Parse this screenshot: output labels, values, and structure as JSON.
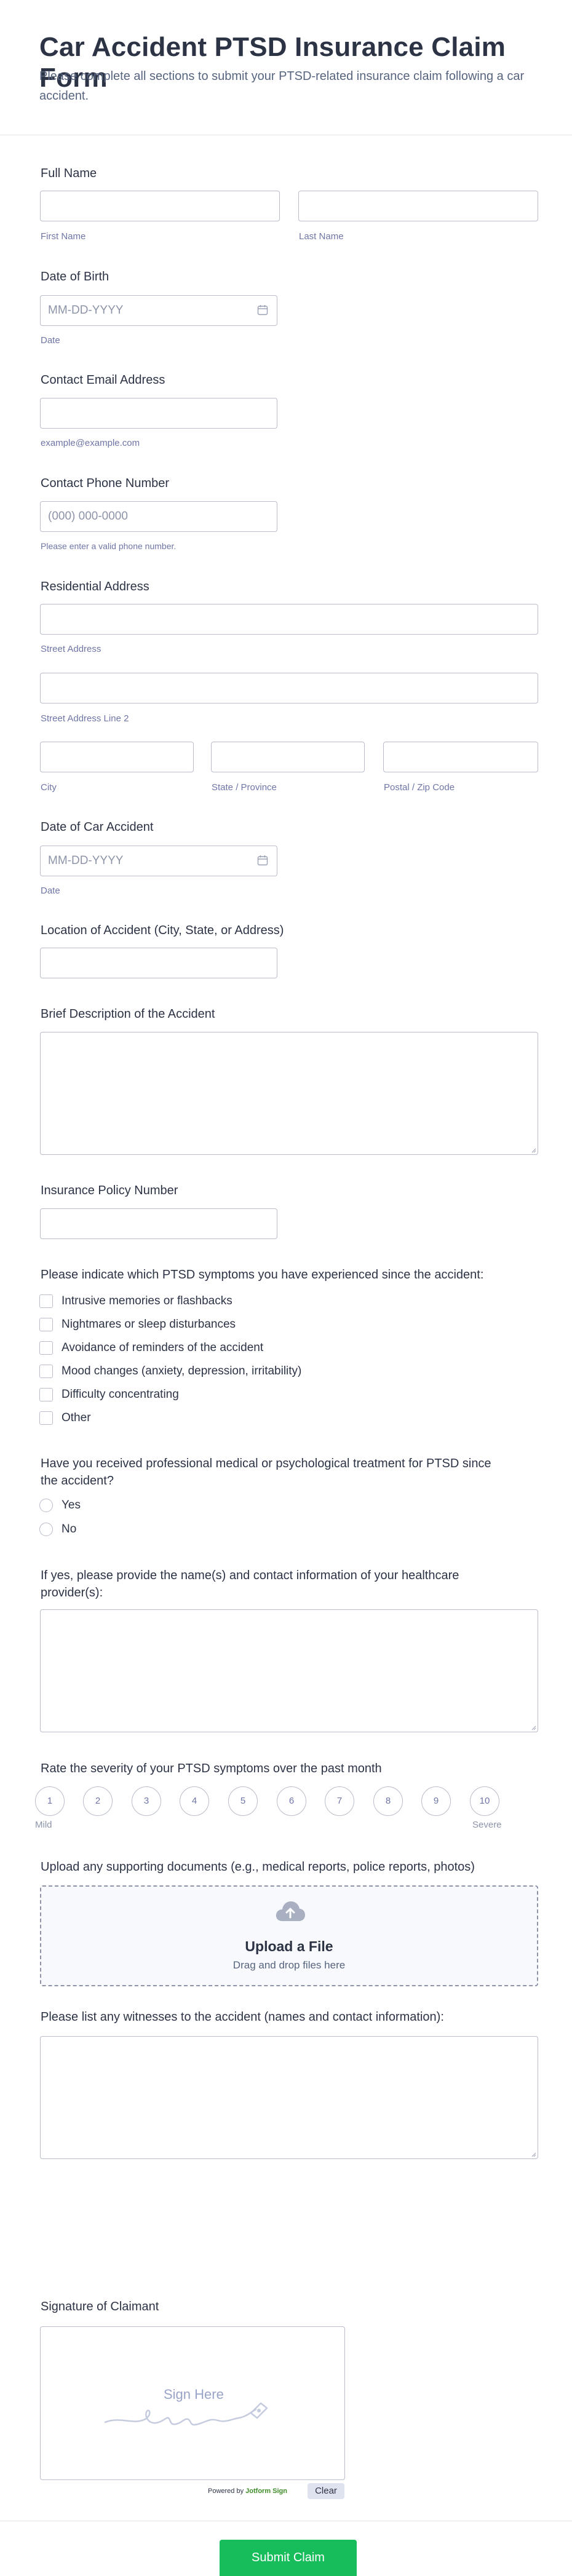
{
  "form": {
    "title": "Car Accident PTSD Insurance Claim Form",
    "subtitle": "Please complete all sections to submit your PTSD-related insurance claim following a car accident."
  },
  "full_name": {
    "label": "Full Name",
    "first_sub": "First Name",
    "last_sub": "Last Name"
  },
  "dob": {
    "label": "Date of Birth",
    "placeholder": "MM-DD-YYYY",
    "sub": "Date"
  },
  "email": {
    "label": "Contact Email Address",
    "sub": "example@example.com"
  },
  "phone": {
    "label": "Contact Phone Number",
    "placeholder": "(000) 000-0000",
    "sub": "Please enter a valid phone number."
  },
  "address": {
    "label": "Residential Address",
    "street_sub": "Street Address",
    "street2_sub": "Street Address Line 2",
    "city_sub": "City",
    "state_sub": "State / Province",
    "zip_sub": "Postal / Zip Code"
  },
  "accident_date": {
    "label": "Date of Car Accident",
    "placeholder": "MM-DD-YYYY",
    "sub": "Date"
  },
  "location": {
    "label": "Location of Accident (City, State, or Address)"
  },
  "description": {
    "label": "Brief Description of the Accident"
  },
  "policy": {
    "label": "Insurance Policy Number"
  },
  "symptoms": {
    "label": "Please indicate which PTSD symptoms you have experienced since the accident:",
    "options": [
      "Intrusive memories or flashbacks",
      "Nightmares or sleep disturbances",
      "Avoidance of reminders of the accident",
      "Mood changes (anxiety, depression, irritability)",
      "Difficulty concentrating",
      "Other"
    ]
  },
  "treatment": {
    "label_line1": "Have you received professional medical or psychological treatment for PTSD since",
    "label_line2": "the accident?",
    "options": [
      "Yes",
      "No"
    ]
  },
  "providers": {
    "label_line1": "If yes, please provide the name(s) and contact information of your healthcare",
    "label_line2": "provider(s):"
  },
  "severity": {
    "label": "Rate the severity of your PTSD symptoms over the past month",
    "values": [
      "1",
      "2",
      "3",
      "4",
      "5",
      "6",
      "7",
      "8",
      "9",
      "10"
    ],
    "min_label": "Mild",
    "max_label": "Severe"
  },
  "upload": {
    "label": "Upload any supporting documents (e.g., medical reports, police reports, photos)",
    "title": "Upload a File",
    "sub": "Drag and drop files here"
  },
  "witnesses": {
    "label": "Please list any witnesses to the accident (names and contact information):"
  },
  "signature": {
    "label": "Signature of Claimant",
    "placeholder": "Sign Here",
    "powered_prefix": "Powered by",
    "powered_brand": "Jotform Sign",
    "clear_label": "Clear"
  },
  "submit_label": "Submit Claim",
  "colors": {
    "submit": "#18bd5b",
    "text": "#2c3345",
    "border": "#b8bdc9",
    "sub_text": "#6f76a7"
  }
}
